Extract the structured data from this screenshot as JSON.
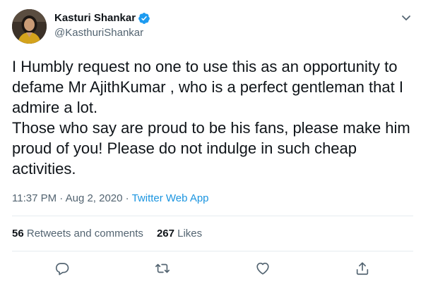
{
  "user": {
    "display_name": "Kasturi Shankar",
    "handle": "@KasthuriShankar",
    "verified": true
  },
  "tweet": {
    "lines": [
      "I Humbly request no one to use this as an opportunity to defame Mr AjithKumar , who is a perfect gentleman that I admire a lot.",
      "Those who say are proud to be his fans, please make him proud of you!  Please do not indulge in such cheap activities."
    ],
    "timestamp": "11:37 PM · Aug 2, 2020 · ",
    "source": "Twitter Web App"
  },
  "stats": {
    "retweets_count": "56",
    "retweets_label": " Retweets and comments",
    "likes_count": "267",
    "likes_label": " Likes"
  },
  "icons": {
    "verified": "verified-badge-icon",
    "caret": "chevron-down-icon",
    "reply": "reply-icon",
    "retweet": "retweet-icon",
    "like": "heart-icon",
    "share": "share-icon"
  },
  "colors": {
    "text": "#0f1419",
    "secondary": "#536471",
    "link": "#1b95e0",
    "verified": "#1d9bf0",
    "divider": "#e6ecf0"
  }
}
